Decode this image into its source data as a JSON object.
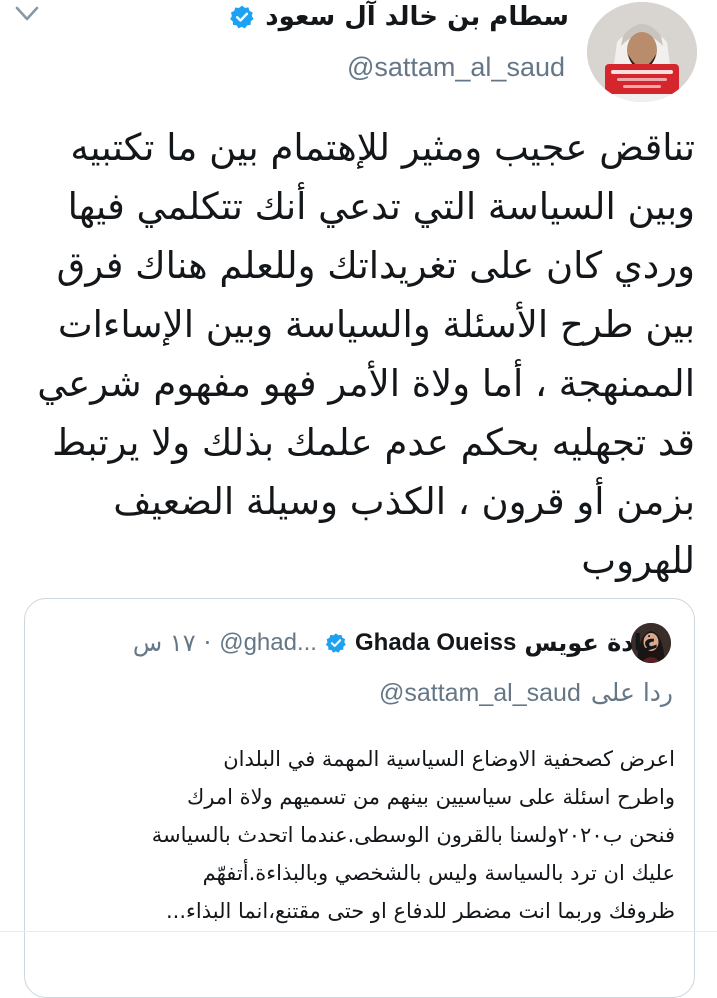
{
  "tweet": {
    "author": {
      "name": "سطام بن خالد آل سعود",
      "handle": "@sattam_al_saud",
      "verified": true
    },
    "text_lines": [
      "تناقض عجيب ومثير للإهتمام بين ما تكتبيه",
      "وبين السياسة التي تدعي أنك تتكلمي فيها",
      "وردي كان على تغريداتك وللعلم هناك فرق",
      "بين طرح الأسئلة والسياسة وبين الإساءات",
      "الممنهجة ، أما ولاة الأمر فهو مفهوم شرعي",
      "قد تجهليه بحكم عدم علمك بذلك ولا يرتبط",
      "بزمن أو قرون ، الكذب وسيلة الضعيف",
      "للهروب"
    ]
  },
  "quoted_tweet": {
    "name_ar": "غادة عويس",
    "name_en": "Ghada Oueiss",
    "verified": true,
    "handle": "@ghad...",
    "separator": "·",
    "time": "١٧ س",
    "reply_label": "ردا على",
    "reply_handle": "@sattam_al_saud",
    "text_lines": [
      "اعرض كصحفية الاوضاع السياسية المهمة في البلدان",
      "واطرح اسئلة على سياسيين بينهم من تسميهم ولاة امرك",
      "فنحن ب٢٠٢٠ولسنا بالقرون الوسطى.عندما اتحدث بالسياسة",
      "عليك ان ترد بالسياسة وليس بالشخصي وبالبذاءة.أتفهّم",
      "ظروفك وربما انت مضطر للدفاع او حتى مقتنع،انما البذاء..."
    ]
  },
  "icons": {
    "menu": "chevron-down-icon",
    "verified": "verified-badge-icon"
  },
  "colors": {
    "text_primary": "#14171a",
    "text_secondary": "#657786",
    "verified_blue": "#1da1f2",
    "border": "#ccd6dd"
  }
}
